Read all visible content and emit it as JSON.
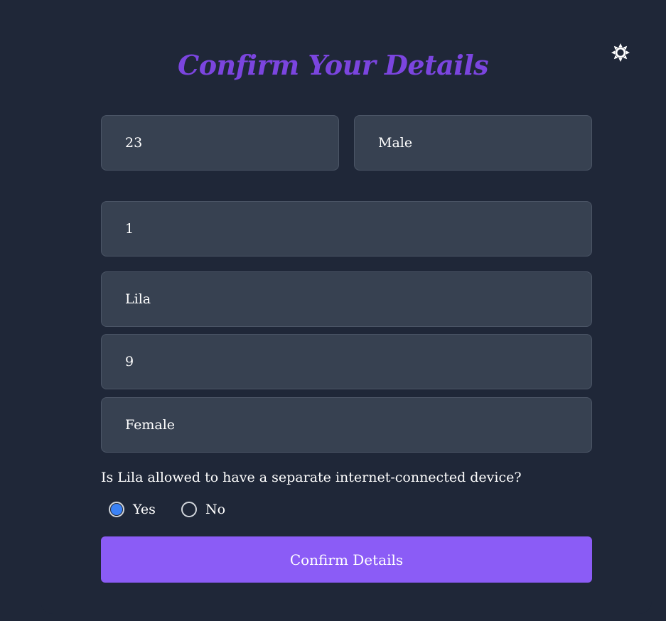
{
  "title": "Confirm Your Details",
  "theme_toggle": {
    "icon": "sun-icon"
  },
  "fields": {
    "age": "23",
    "gender": "Male",
    "children_count": "1",
    "child_name": "Lila",
    "child_age": "9",
    "child_gender": "Female"
  },
  "question": "Is Lila allowed to have a separate internet-connected device?",
  "options": {
    "yes": "Yes",
    "no": "No",
    "selected": "Yes"
  },
  "confirm_label": "Confirm Details",
  "colors": {
    "background": "#1f2738",
    "field": "#374151",
    "title": "#7b45df",
    "button": "#8b5cf6",
    "radio_selected": "#3b82f6"
  }
}
